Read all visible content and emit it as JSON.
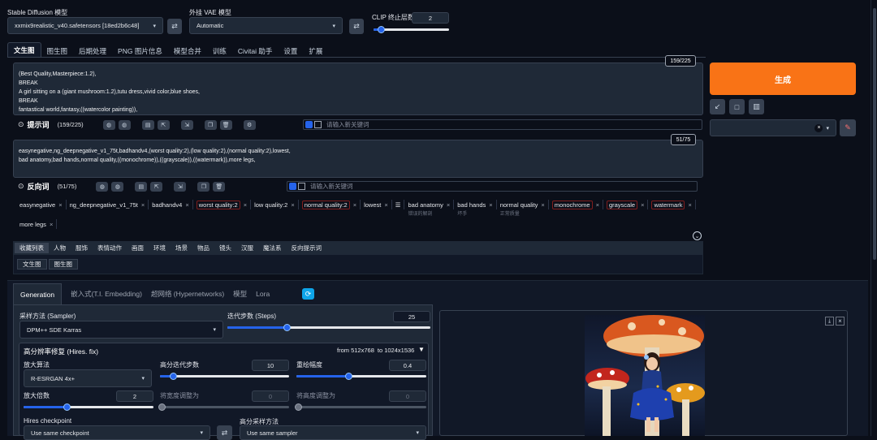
{
  "top": {
    "model_label": "Stable Diffusion 模型",
    "model_value": "xxmix9realistic_v40.safetensors [18ed2b6c48]",
    "vae_label": "外挂 VAE 模型",
    "vae_value": "Automatic",
    "clip_label": "CLIP 终止层数",
    "clip_value": "2",
    "clip_fraction": 0.1
  },
  "tabs": [
    "文生图",
    "图生图",
    "后期处理",
    "PNG 图片信息",
    "模型合并",
    "训练",
    "Civitai 助手",
    "设置",
    "扩展"
  ],
  "positive": {
    "lines": [
      "(Best Quality,Masterpiece:1.2),",
      "BREAK",
      "A girl sitting on a (giant mushroom:1.2),tutu dress,vivid color,blue shoes,",
      "BREAK",
      "fantastical world,fantasy,((watercolor painting)),"
    ],
    "counter": "159/225",
    "label": "提示词",
    "count": "(159/225)",
    "keyword_placeholder": "请输入新关键词"
  },
  "negative": {
    "lines": [
      "easynegative,ng_deepnegative_v1_75t,badhandv4,(worst quality:2),(low quality:2),(normal quality:2),lowest,",
      "bad anatomy,bad hands,normal quality,((monochrome)),((grayscale)),((watermark)),more legs,"
    ],
    "counter": "51/75",
    "label": "反向词",
    "count": "(51/75)",
    "keyword_placeholder": "请输入新关键词"
  },
  "neg_tags": [
    {
      "t": "easynegative",
      "sub": ""
    },
    {
      "t": "ng_deepnegative_v1_75t",
      "sub": ""
    },
    {
      "t": "badhandv4",
      "sub": ""
    },
    {
      "t": "worst quality:2",
      "sub": "",
      "red": true
    },
    {
      "t": "low quality:2",
      "sub": ""
    },
    {
      "t": "normal quality:2",
      "sub": "",
      "red": true
    },
    {
      "t": "lowest",
      "sub": ""
    },
    {
      "t": "bad anatomy",
      "sub": "错误的解剖"
    },
    {
      "t": "bad hands",
      "sub": "坏手"
    },
    {
      "t": "normal quality",
      "sub": "正常质量"
    },
    {
      "t": "monochrome",
      "sub": "",
      "red": true
    },
    {
      "t": "grayscale",
      "sub": "",
      "red": true
    },
    {
      "t": "watermark",
      "sub": "",
      "red": true
    },
    {
      "t": "more legs",
      "sub": ""
    }
  ],
  "categories": [
    "收藏列表",
    "人物",
    "服饰",
    "表情动作",
    "画面",
    "环境",
    "场景",
    "物品",
    "镜头",
    "汉服",
    "魔法系",
    "反向提示词"
  ],
  "subcats": [
    "文生图",
    "图生图"
  ],
  "generate": {
    "label": "生成",
    "tool_icons": [
      "arrow-icon",
      "stop-icon",
      "trash-icon"
    ]
  },
  "gen_tabs": [
    "Generation",
    "嵌入式(T.I. Embedding)",
    "超网络 (Hypernetworks)",
    "模型",
    "Lora"
  ],
  "sampler": {
    "label": "采样方法 (Sampler)",
    "value": "DPM++ SDE Karras"
  },
  "steps": {
    "label": "迭代步数 (Steps)",
    "value": "25",
    "fraction": 0.29
  },
  "hires": {
    "title": "高分辨率修复 (Hires. fix)",
    "from": "from 512x768",
    "to": "to 1024x1536",
    "upscaler_label": "放大算法",
    "upscaler_value": "R-ESRGAN 4x+",
    "hires_steps_label": "高分迭代步数",
    "hires_steps_value": "10",
    "hires_steps_fraction": 0.1,
    "denoise_label": "重绘幅度",
    "denoise_value": "0.4",
    "denoise_fraction": 0.4,
    "scale_label": "放大倍数",
    "scale_value": "2",
    "scale_fraction": 0.33,
    "width_label": "将宽度调整为",
    "width_value": "0",
    "height_label": "将高度调整为",
    "height_value": "0",
    "checkpoint_label": "Hires checkpoint",
    "checkpoint_value": "Use same checkpoint",
    "sampler_label": "高分采样方法",
    "sampler_value": "Use same sampler"
  },
  "colors": {
    "accent": "#f97316",
    "slider": "#2563eb",
    "bg": "#0b0f19"
  }
}
